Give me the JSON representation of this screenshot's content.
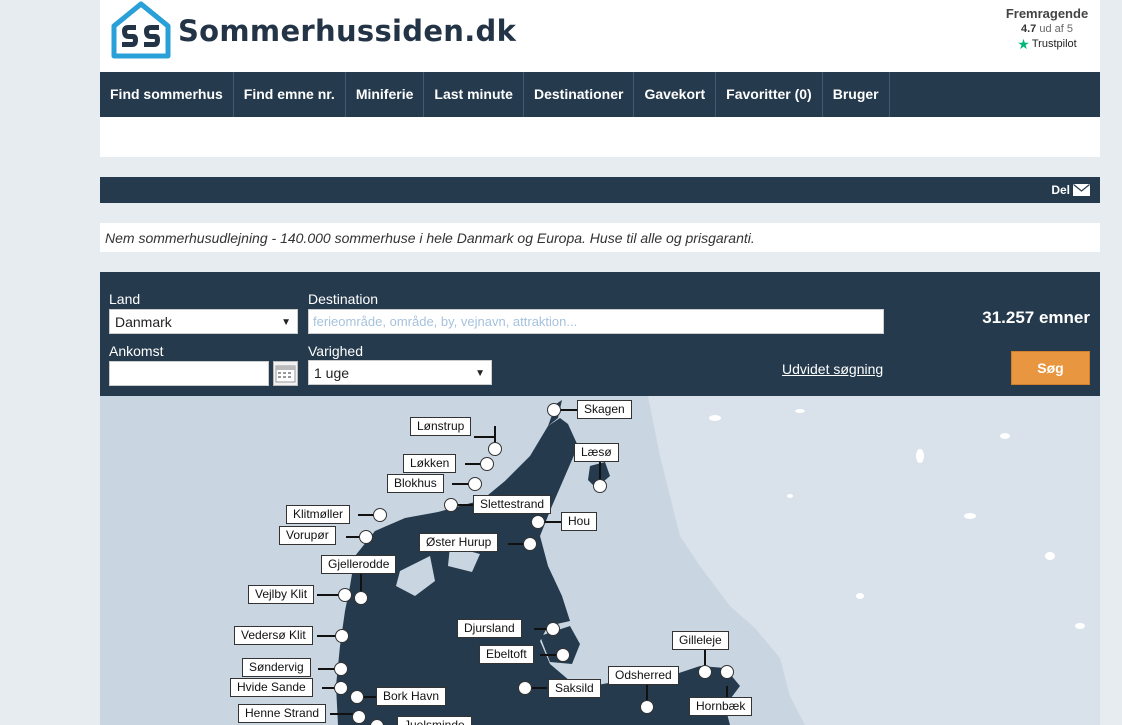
{
  "brand": {
    "name": "Sommerhussiden.dk",
    "logo_icon": "house-logo-icon"
  },
  "trustpilot": {
    "rating_text": "Fremragende",
    "score": "4.7",
    "score_suffix": "ud af 5",
    "brand": "Trustpilot",
    "star_color": "#00b67a"
  },
  "nav": {
    "items": [
      {
        "label": "Find sommerhus"
      },
      {
        "label": "Find emne nr."
      },
      {
        "label": "Miniferie"
      },
      {
        "label": "Last minute"
      },
      {
        "label": "Destinationer"
      },
      {
        "label": "Gavekort"
      },
      {
        "label": "Favoritter (0)"
      },
      {
        "label": "Bruger"
      }
    ]
  },
  "share": {
    "label": "Del",
    "icon": "envelope-icon"
  },
  "tagline": "Nem sommerhusudlejning - 140.000 sommerhuse i hele Danmark og Europa. Huse til alle og prisgaranti.",
  "search": {
    "land_label": "Land",
    "land_value": "Danmark",
    "destination_label": "Destination",
    "destination_placeholder": "ferieområde, område, by, vejnavn, attraktion...",
    "ankomst_label": "Ankomst",
    "ankomst_value": "",
    "varighed_label": "Varighed",
    "varighed_value": "1 uge",
    "result_count": "31.257 emner",
    "advanced_link": "Udvidet søgning",
    "search_button": "Søg",
    "accent_color": "#e8963f"
  },
  "map": {
    "labels": [
      "Skagen",
      "Lønstrup",
      "Læsø",
      "Løkken",
      "Blokhus",
      "Slettestrand",
      "Hou",
      "Klitmøller",
      "Vorupør",
      "Øster Hurup",
      "Gjellerodde",
      "Vejlby Klit",
      "Djursland",
      "Vedersø Klit",
      "Gilleleje",
      "Ebeltoft",
      "Søndervig",
      "Odsherred",
      "Hvide Sande",
      "Saksild",
      "Bork Havn",
      "Hornbæk",
      "Henne Strand",
      "Juelsminde"
    ]
  },
  "colors": {
    "navy": "#253a4d",
    "land": "#253a4d",
    "sea": "#c9d6e2"
  }
}
